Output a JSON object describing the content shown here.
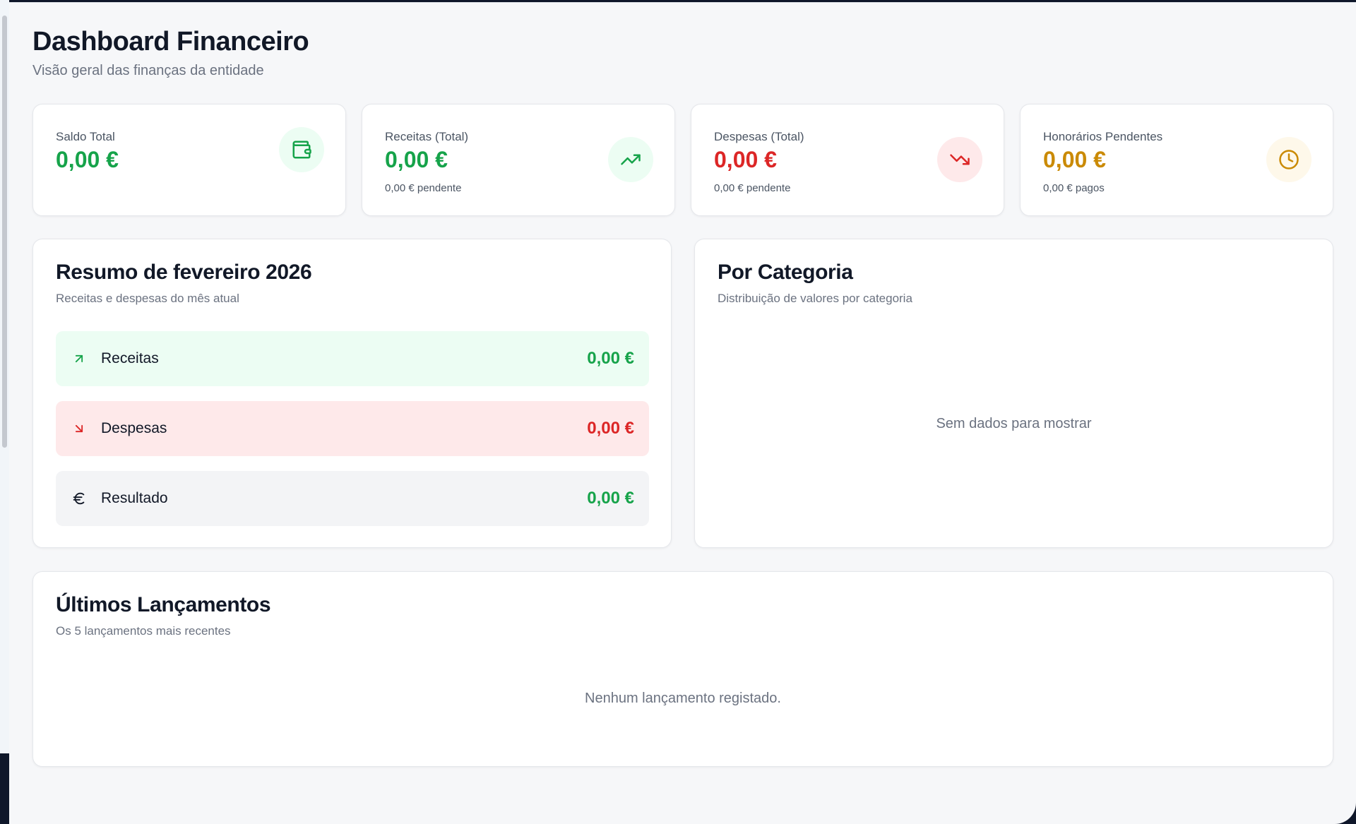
{
  "colors": {
    "green": "#16a34a",
    "red": "#dc2626",
    "amber": "#ca8a04",
    "green_bg": "#ecfdf3",
    "red_bg": "#fee9ea",
    "amber_bg": "#fef8ea",
    "neutral_bg": "#f3f4f6"
  },
  "header": {
    "title": "Dashboard Financeiro",
    "subtitle": "Visão geral das finanças da entidade"
  },
  "stats": [
    {
      "label": "Saldo Total",
      "value": "0,00 €",
      "sub": "",
      "icon": "wallet-icon"
    },
    {
      "label": "Receitas (Total)",
      "value": "0,00 €",
      "sub": "0,00 € pendente",
      "icon": "trending-up-icon"
    },
    {
      "label": "Despesas (Total)",
      "value": "0,00 €",
      "sub": "0,00 € pendente",
      "icon": "trending-down-icon"
    },
    {
      "label": "Honorários Pendentes",
      "value": "0,00 €",
      "sub": "0,00 € pagos",
      "icon": "clock-icon"
    }
  ],
  "summary": {
    "title": "Resumo de fevereiro 2026",
    "subtitle": "Receitas e despesas do mês atual",
    "rows": [
      {
        "label": "Receitas",
        "value": "0,00 €",
        "icon": "arrow-up-right-icon"
      },
      {
        "label": "Despesas",
        "value": "0,00 €",
        "icon": "arrow-down-right-icon"
      },
      {
        "label": "Resultado",
        "value": "0,00 €",
        "icon": "euro-icon"
      }
    ]
  },
  "category": {
    "title": "Por Categoria",
    "subtitle": "Distribuição de valores por categoria",
    "empty": "Sem dados para mostrar"
  },
  "recent": {
    "title": "Últimos Lançamentos",
    "subtitle": "Os 5 lançamentos mais recentes",
    "empty": "Nenhum lançamento registado."
  }
}
